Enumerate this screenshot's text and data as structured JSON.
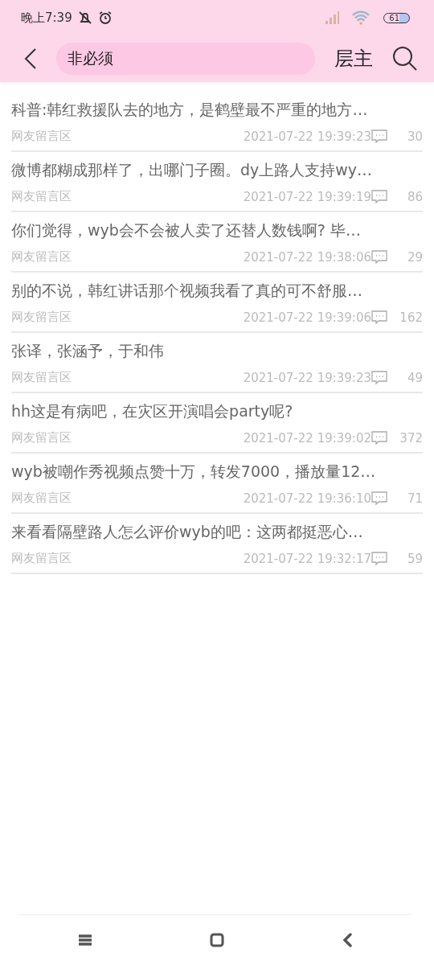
{
  "status_bar": {
    "time": "晚上7:39",
    "battery": "61"
  },
  "header": {
    "search": {
      "value": "非必须"
    },
    "floor_button": "层主"
  },
  "posts": [
    {
      "title": "科普:韩红救援队去的地方，是鹤壁最不严重的地方…",
      "source": "网友留言区",
      "time": "2021-07-22 19:39:23",
      "comments": "30"
    },
    {
      "title": "微博都糊成那样了，出哪门子圈。dy上路人支持wy…",
      "source": "网友留言区",
      "time": "2021-07-22 19:39:19",
      "comments": "86"
    },
    {
      "title": "你们觉得，wyb会不会被人卖了还替人数钱啊? 毕…",
      "source": "网友留言区",
      "time": "2021-07-22 19:38:06",
      "comments": "29"
    },
    {
      "title": "别的不说，韩红讲话那个视频我看了真的可不舒服…",
      "source": "网友留言区",
      "time": "2021-07-22 19:39:06",
      "comments": "162"
    },
    {
      "title": "张译，张涵予，于和伟",
      "source": "网友留言区",
      "time": "2021-07-22 19:39:23",
      "comments": "49"
    },
    {
      "title": "hh这是有病吧，在灾区开演唱会party呢?",
      "source": "网友留言区",
      "time": "2021-07-22 19:39:02",
      "comments": "372"
    },
    {
      "title": "wyb被嘲作秀视频点赞十万，转发7000，播放量12…",
      "source": "网友留言区",
      "time": "2021-07-22 19:36:10",
      "comments": "71"
    },
    {
      "title": "来看看隔壁路人怎么评价wyb的吧：这两都挺恶心…",
      "source": "网友留言区",
      "time": "2021-07-22 19:32:17",
      "comments": "59"
    }
  ]
}
